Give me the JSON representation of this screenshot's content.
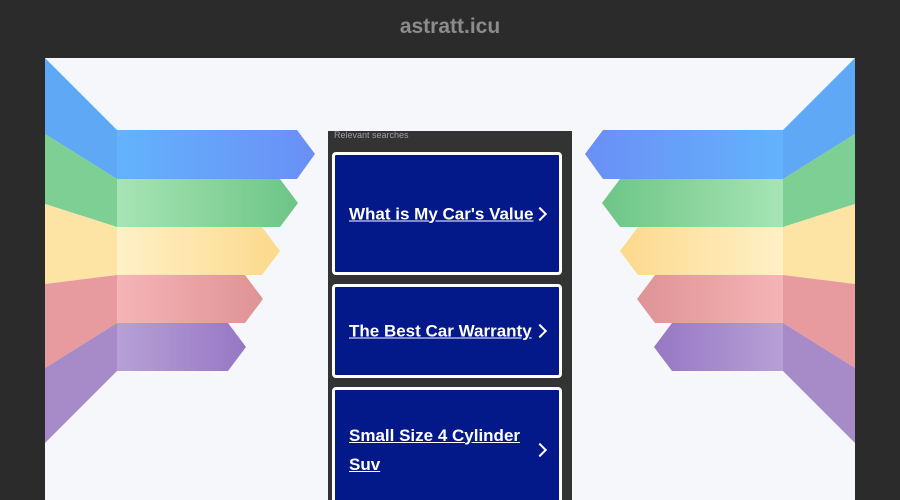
{
  "header": {
    "domain": "astratt.icu"
  },
  "panel": {
    "title": "Relevant searches",
    "cards": [
      {
        "label": "What is My Car's Value",
        "icon": "chevron-right-icon"
      },
      {
        "label": "The Best Car Warranty",
        "icon": "chevron-right-icon"
      },
      {
        "label": "Small Size 4 Cylinder Suv",
        "icon": "chevron-right-icon"
      }
    ]
  },
  "colors": {
    "background": "#2b2b2b",
    "stage": "#f6f7fa",
    "card": "#03198a",
    "band_blue": "#62a8fb",
    "band_green": "#7fd39a",
    "band_yellow": "#fde4a0",
    "band_red": "#efa5a8",
    "band_purple": "#a88bc9"
  }
}
